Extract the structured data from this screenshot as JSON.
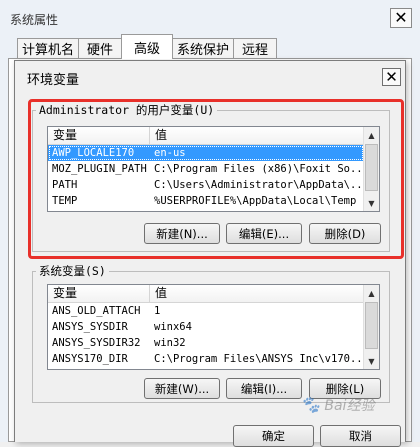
{
  "system_properties": {
    "title": "系统属性",
    "tabs": [
      {
        "label": "计算机名"
      },
      {
        "label": "硬件"
      },
      {
        "label": "高级"
      },
      {
        "label": "系统保护"
      },
      {
        "label": "远程"
      }
    ],
    "active_tab": "高级"
  },
  "env_dialog": {
    "title": "环境变量",
    "user_vars": {
      "group_label": "Administrator 的用户变量(U)",
      "columns": [
        "变量",
        "值"
      ],
      "rows": [
        {
          "name": "AWP_LOCALE170",
          "value": "en-us",
          "selected": true
        },
        {
          "name": "MOZ_PLUGIN_PATH",
          "value": "C:\\Program Files (x86)\\Foxit So..."
        },
        {
          "name": "PATH",
          "value": "C:\\Users\\Administrator\\AppData\\..."
        },
        {
          "name": "TEMP",
          "value": "%USERPROFILE%\\AppData\\Local\\Temp"
        }
      ],
      "buttons": {
        "new": "新建(N)...",
        "edit": "编辑(E)...",
        "delete": "删除(D)"
      }
    },
    "system_vars": {
      "group_label": "系统变量(S)",
      "columns": [
        "变量",
        "值"
      ],
      "rows": [
        {
          "name": "ANS_OLD_ATTACH",
          "value": "1"
        },
        {
          "name": "ANSYS_SYSDIR",
          "value": "winx64"
        },
        {
          "name": "ANSYS_SYSDIR32",
          "value": "win32"
        },
        {
          "name": "ANSYS170_DIR",
          "value": "C:\\Program Files\\ANSYS Inc\\v170..."
        }
      ],
      "buttons": {
        "new": "新建(W)...",
        "edit": "编辑(I)...",
        "delete": "删除(L)"
      }
    },
    "ok_label": "确定",
    "cancel_label": "取消"
  },
  "watermark": {
    "text": "Bai经验"
  },
  "colors": {
    "selection": "#3399ff",
    "highlight_box": "#e8302a"
  }
}
